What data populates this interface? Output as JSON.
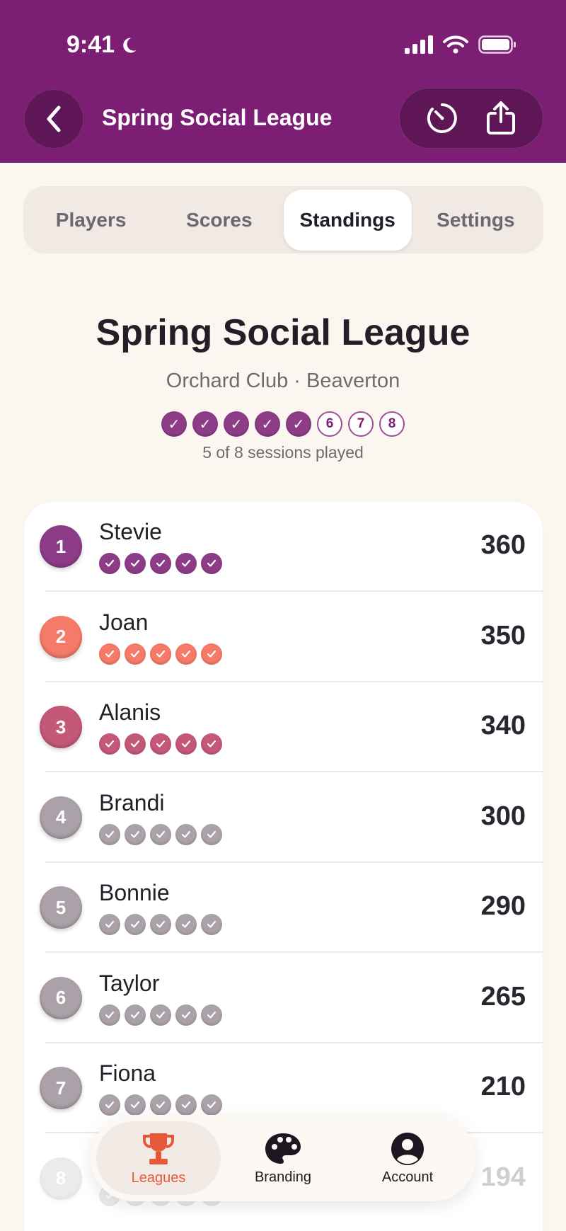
{
  "status_bar": {
    "time": "9:41"
  },
  "nav": {
    "title": "Spring Social League"
  },
  "segments": [
    {
      "label": "Players",
      "active": false
    },
    {
      "label": "Scores",
      "active": false
    },
    {
      "label": "Standings",
      "active": true
    },
    {
      "label": "Settings",
      "active": false
    }
  ],
  "league": {
    "name": "Spring Social League",
    "location": "Orchard Club · Beaverton",
    "sessions": [
      {
        "done": true,
        "label": "✓"
      },
      {
        "done": true,
        "label": "✓"
      },
      {
        "done": true,
        "label": "✓"
      },
      {
        "done": true,
        "label": "✓"
      },
      {
        "done": true,
        "label": "✓"
      },
      {
        "done": false,
        "label": "6"
      },
      {
        "done": false,
        "label": "7"
      },
      {
        "done": false,
        "label": "8"
      }
    ],
    "sessions_caption": "5 of 8 sessions played"
  },
  "standings": [
    {
      "rank": "1",
      "name": "Stevie",
      "score": "360",
      "played": 5,
      "color": "#8d3c87"
    },
    {
      "rank": "2",
      "name": "Joan",
      "score": "350",
      "played": 5,
      "color": "#f57a68"
    },
    {
      "rank": "3",
      "name": "Alanis",
      "score": "340",
      "played": 5,
      "color": "#c45878"
    },
    {
      "rank": "4",
      "name": "Brandi",
      "score": "300",
      "played": 5,
      "color": "#aaa2a8"
    },
    {
      "rank": "5",
      "name": "Bonnie",
      "score": "290",
      "played": 5,
      "color": "#aaa2a8"
    },
    {
      "rank": "6",
      "name": "Taylor",
      "score": "265",
      "played": 5,
      "color": "#aaa2a8"
    },
    {
      "rank": "7",
      "name": "Fiona",
      "score": "210",
      "played": 5,
      "color": "#aaa2a8"
    },
    {
      "rank": "8",
      "name": "",
      "score": "194",
      "played": 5,
      "color": "#aaa2a8"
    }
  ],
  "tabbar": [
    {
      "label": "Leagues",
      "icon": "trophy-icon",
      "active": true
    },
    {
      "label": "Branding",
      "icon": "palette-icon",
      "active": false
    },
    {
      "label": "Account",
      "icon": "account-icon",
      "active": false
    }
  ],
  "colors": {
    "header": "#7c1e73",
    "accent": "#e9573a",
    "gold": "#8d3c87",
    "silver": "#f57a68",
    "bronze": "#c45878",
    "neutral": "#aaa2a8"
  }
}
